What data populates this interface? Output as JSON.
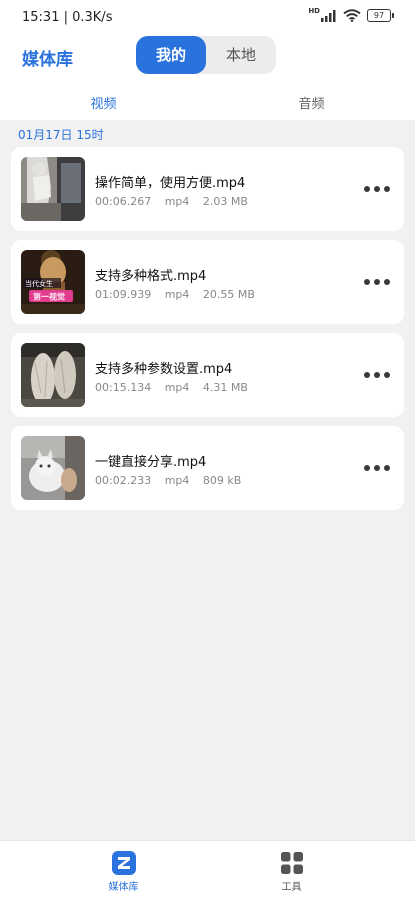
{
  "status_bar": {
    "time": "15:31 | 0.3K/s",
    "hd": "HD",
    "battery": "97"
  },
  "header": {
    "title": "媒体库",
    "segments": [
      "我的",
      "本地"
    ]
  },
  "tabs": [
    "视频",
    "音频"
  ],
  "date_header": "01月17日  15时",
  "files": [
    {
      "name": "操作简单，使用方便.mp4",
      "duration": "00:06.267",
      "format": "mp4",
      "size": "2.03 MB"
    },
    {
      "name": "支持多种格式.mp4",
      "duration": "01:09.939",
      "format": "mp4",
      "size": "20.55 MB"
    },
    {
      "name": "支持多种参数设置.mp4",
      "duration": "00:15.134",
      "format": "mp4",
      "size": "4.31 MB"
    },
    {
      "name": "一键直接分享.mp4",
      "duration": "00:02.233",
      "format": "mp4",
      "size": "809 kB"
    }
  ],
  "thumb_overlay": {
    "line1": "当代女生",
    "line2": "第一视觉"
  },
  "bottom_nav": [
    {
      "label": "媒体库",
      "icon": "z-logo-icon",
      "active": true
    },
    {
      "label": "工具",
      "icon": "grid-icon",
      "active": false
    }
  ],
  "colors": {
    "accent": "#2a72de",
    "background": "#f1f1f1",
    "card": "#ffffff"
  }
}
